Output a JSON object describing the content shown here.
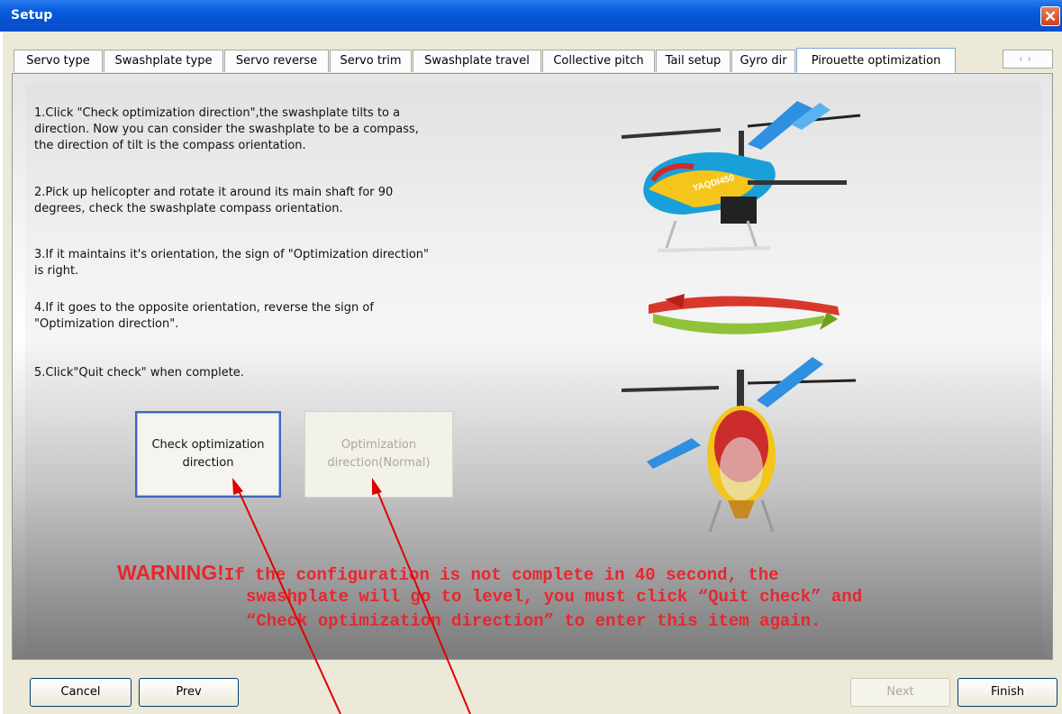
{
  "window": {
    "title": "Setup",
    "close_symbol": "✕"
  },
  "tabs": [
    {
      "label": "Servo type",
      "active": false
    },
    {
      "label": "Swashplate type",
      "active": false
    },
    {
      "label": "Servo reverse",
      "active": false
    },
    {
      "label": "Servo trim",
      "active": false
    },
    {
      "label": "Swashplate travel",
      "active": false
    },
    {
      "label": "Collective pitch",
      "active": false
    },
    {
      "label": "Tail setup",
      "active": false
    },
    {
      "label": "Gyro dir",
      "active": false
    },
    {
      "label": "Pirouette optimization",
      "active": true
    }
  ],
  "tab_scroll": {
    "left": "‹",
    "right": "›"
  },
  "instructions": {
    "step1_l1": "1.Click \"Check optimization direction\",the swashplate tilts to a",
    "step1_l2": "direction. Now you can consider the swashplate to be a compass,",
    "step1_l3": "the direction of tilt is the compass orientation.",
    "step2_l1": "2.Pick up helicopter and rotate it around its main shaft for 90",
    "step2_l2": "degrees, check the swashplate compass orientation.",
    "step3_l1": "3.If it maintains it's orientation, the sign of \"Optimization direction\"",
    "step3_l2": "is right.",
    "step4_l1": "4.If it goes to the opposite orientation, reverse the sign of",
    "step4_l2": "\"Optimization direction\".",
    "step5": "5.Click\"Quit check\" when complete."
  },
  "buttons": {
    "check_l1": "Check optimization",
    "check_l2": "direction",
    "opt_l1": "Optimization",
    "opt_l2": "direction(Normal)",
    "cancel": "Cancel",
    "prev": "Prev",
    "next": "Next",
    "finish": "Finish"
  },
  "warning": {
    "head": "WARNING!",
    "l1": "If the configuration is not complete in 40 second, the",
    "l2": "swashplate will go to level, you must click “Quit check” and",
    "l3": "“Check optimization direction” to enter this item again."
  },
  "colors": {
    "titlebar": "#0650d0",
    "warning_text": "#e8262e",
    "annotation_arrow": "#e00000"
  },
  "illustration": {
    "helicopter_text": "YAQDI450"
  }
}
